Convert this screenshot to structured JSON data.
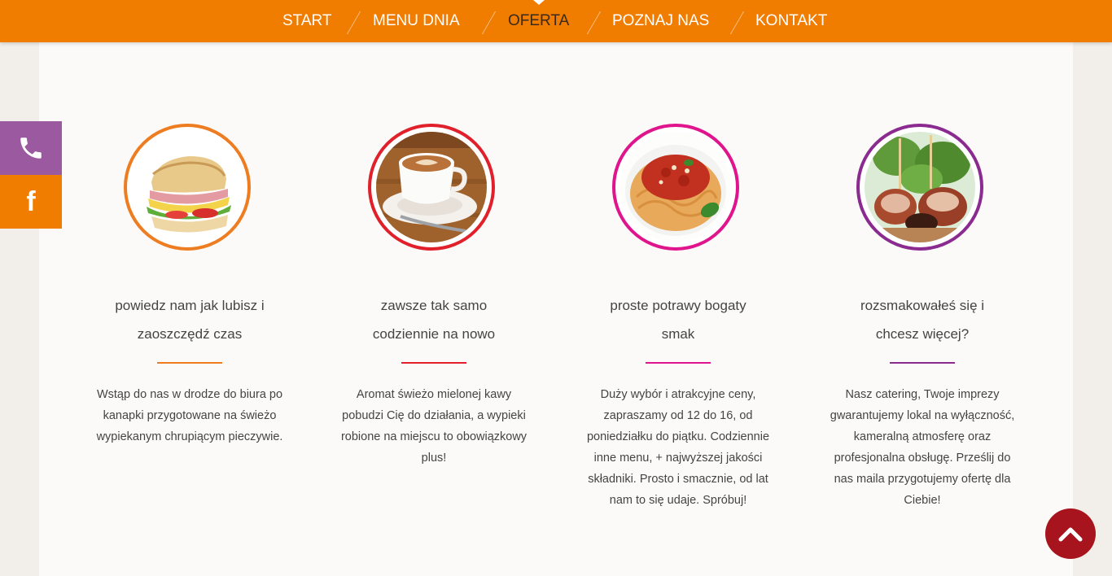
{
  "nav": {
    "items": [
      {
        "label": "START"
      },
      {
        "label": "MENU DNIA"
      },
      {
        "label": "OFERTA"
      },
      {
        "label": "POZNAJ NAS"
      },
      {
        "label": "KONTAKT"
      }
    ],
    "active": "OFERTA",
    "color": "#f07c00"
  },
  "side": {
    "phone_icon": "phone-icon",
    "facebook_icon": "facebook-icon",
    "facebook_glyph": "f",
    "phone_color": "#9b5a9f",
    "facebook_color": "#f07c00"
  },
  "features": [
    {
      "icon": "sandwich-image",
      "title_line1": "powiedz nam jak lubisz i",
      "title_line2": "zaoszczędź czas",
      "accent": "#ee7d22",
      "desc": [
        "Wstąp do nas w drodze do biura po",
        "kanapki przygotowane na świeżo",
        "wypiekanym chrupiącym pieczywie."
      ]
    },
    {
      "icon": "coffee-image",
      "title_line1": "zawsze tak samo",
      "title_line2": "codziennie na nowo",
      "accent": "#e0202a",
      "desc": [
        "Aromat świeżo mielonej kawy",
        "pobudzi Cię do działania, a wypieki",
        "robione na miejscu to obowiązkowy",
        "plus!"
      ]
    },
    {
      "icon": "spaghetti-image",
      "title_line1": "proste potrawy bogaty",
      "title_line2": "smak",
      "accent": "#e0148c",
      "desc": [
        "Duży wybór i atrakcyjne ceny,",
        "zapraszamy od 12 do 16, od",
        "poniedziałku do piątku. Codziennie",
        "inne menu, + najwyższej jakości",
        "składniki. Prosto i smacznie, od lat",
        "nam to się udaje. Spróbuj!"
      ]
    },
    {
      "icon": "bacon-rolls-image",
      "title_line1": "rozsmakowałeś się i",
      "title_line2": "chcesz więcej?",
      "accent": "#8b2a8f",
      "desc": [
        "Nasz catering, Twoje imprezy",
        "gwarantujemy lokal na wyłączność,",
        "kameralną atmosferę oraz",
        "profesjonalna obsługę. Prześlij do",
        "nas maila przygotujemy ofertę dla",
        "Ciebie!"
      ]
    }
  ],
  "back_to_top": {
    "icon": "chevron-up-icon",
    "color": "#a8141d"
  }
}
